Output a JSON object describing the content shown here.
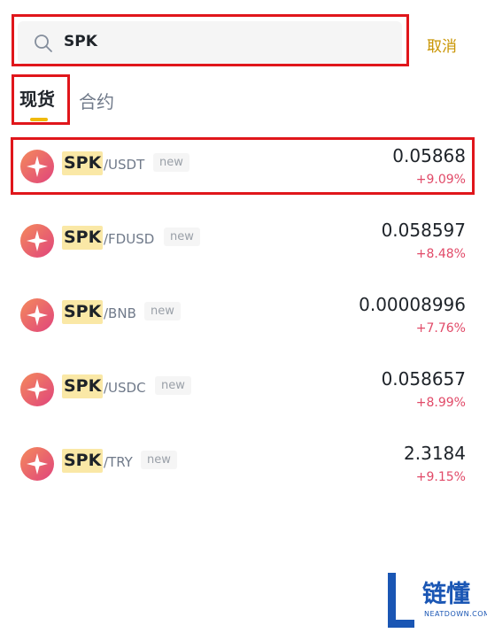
{
  "search": {
    "query": "SPK",
    "cancel_label": "取消"
  },
  "tabs": [
    {
      "label": "现货",
      "active": true
    },
    {
      "label": "合约",
      "active": false
    }
  ],
  "pairs": [
    {
      "base": "SPK",
      "quote": "/USDT",
      "tag": "new",
      "price": "0.05868",
      "change": "+9.09%"
    },
    {
      "base": "SPK",
      "quote": "/FDUSD",
      "tag": "new",
      "price": "0.058597",
      "change": "+8.48%"
    },
    {
      "base": "SPK",
      "quote": "/BNB",
      "tag": "new",
      "price": "0.00008996",
      "change": "+7.76%"
    },
    {
      "base": "SPK",
      "quote": "/USDC",
      "tag": "new",
      "price": "0.058657",
      "change": "+8.99%"
    },
    {
      "base": "SPK",
      "quote": "/TRY",
      "tag": "new",
      "price": "2.3184",
      "change": "+9.15%"
    }
  ],
  "watermark": {
    "text": "链懂",
    "subtext": "NEATDOWN.COM"
  },
  "colors": {
    "accent": "#f0b90b",
    "cancel": "#c99400",
    "positive": "#e14a68",
    "highlight": "#e0161b"
  },
  "icons": {
    "search": "search-icon",
    "coin": "spk-coin-icon"
  }
}
